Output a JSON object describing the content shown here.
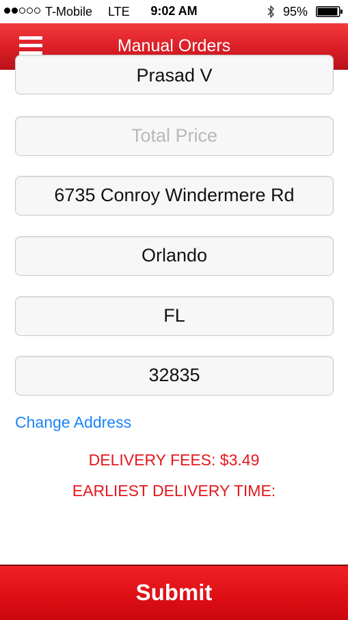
{
  "status_bar": {
    "signal_bars_filled": 2,
    "signal_bars_total": 5,
    "carrier": "T-Mobile",
    "network": "LTE",
    "time": "9:02 AM",
    "battery_percent": "95%",
    "battery_level": 0.95
  },
  "nav": {
    "title": "Manual Orders",
    "menu_icon": "hamburger-menu-icon"
  },
  "form": {
    "name_value": "Prasad V",
    "total_price_placeholder": "Total Price",
    "address_value": "6735 Conroy Windermere Rd",
    "city_value": "Orlando",
    "state_value": "FL",
    "zip_value": "32835"
  },
  "change_address_label": "Change Address",
  "delivery": {
    "fees_text": "DELIVERY FEES: $3.49",
    "earliest_time_text": "EARLIEST DELIVERY TIME:"
  },
  "submit_label": "Submit",
  "colors": {
    "brand_red": "#d91e25",
    "link_blue": "#1a82f7",
    "fee_red": "#e4171d"
  }
}
